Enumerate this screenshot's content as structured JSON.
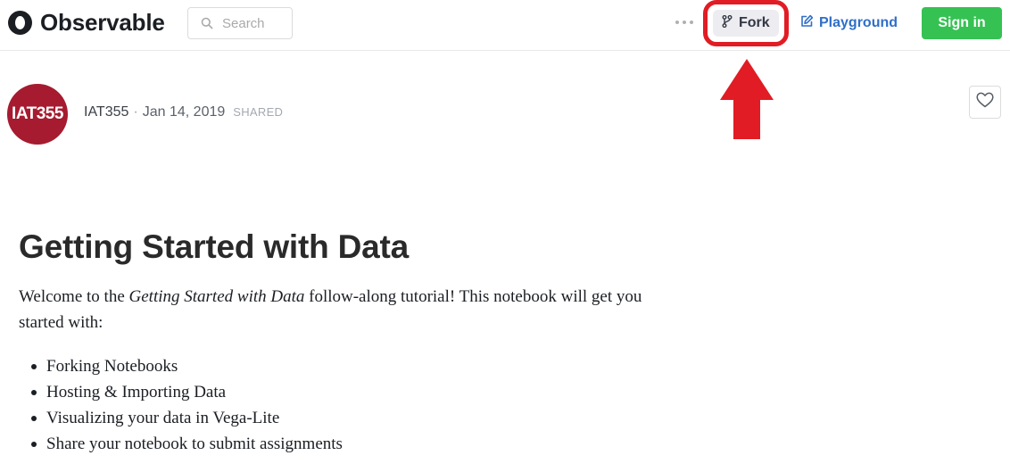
{
  "header": {
    "brand": "Observable",
    "search_placeholder": "Search",
    "more_icon": "more-dots-icon",
    "fork_label": "Fork",
    "playground_label": "Playground",
    "signin_label": "Sign in",
    "accent_green": "#35c253",
    "accent_blue": "#2f6fc9"
  },
  "annotation": {
    "highlight_color": "#e11c24",
    "arrow_icon": "up-arrow-icon"
  },
  "notebook": {
    "avatar_text": "IAT355",
    "author": "IAT355",
    "separator": "·",
    "date": "Jan 14, 2019",
    "status": "SHARED",
    "avatar_color": "#a61b2f",
    "title": "Getting Started with Data",
    "intro_prefix": "Welcome to the ",
    "intro_emphasis": "Getting Started with Data",
    "intro_suffix": " follow-along tutorial! This notebook will get you started with:",
    "bullets": [
      "Forking Notebooks",
      "Hosting & Importing Data",
      "Visualizing your data in Vega-Lite",
      "Share your notebook to submit assignments"
    ]
  }
}
